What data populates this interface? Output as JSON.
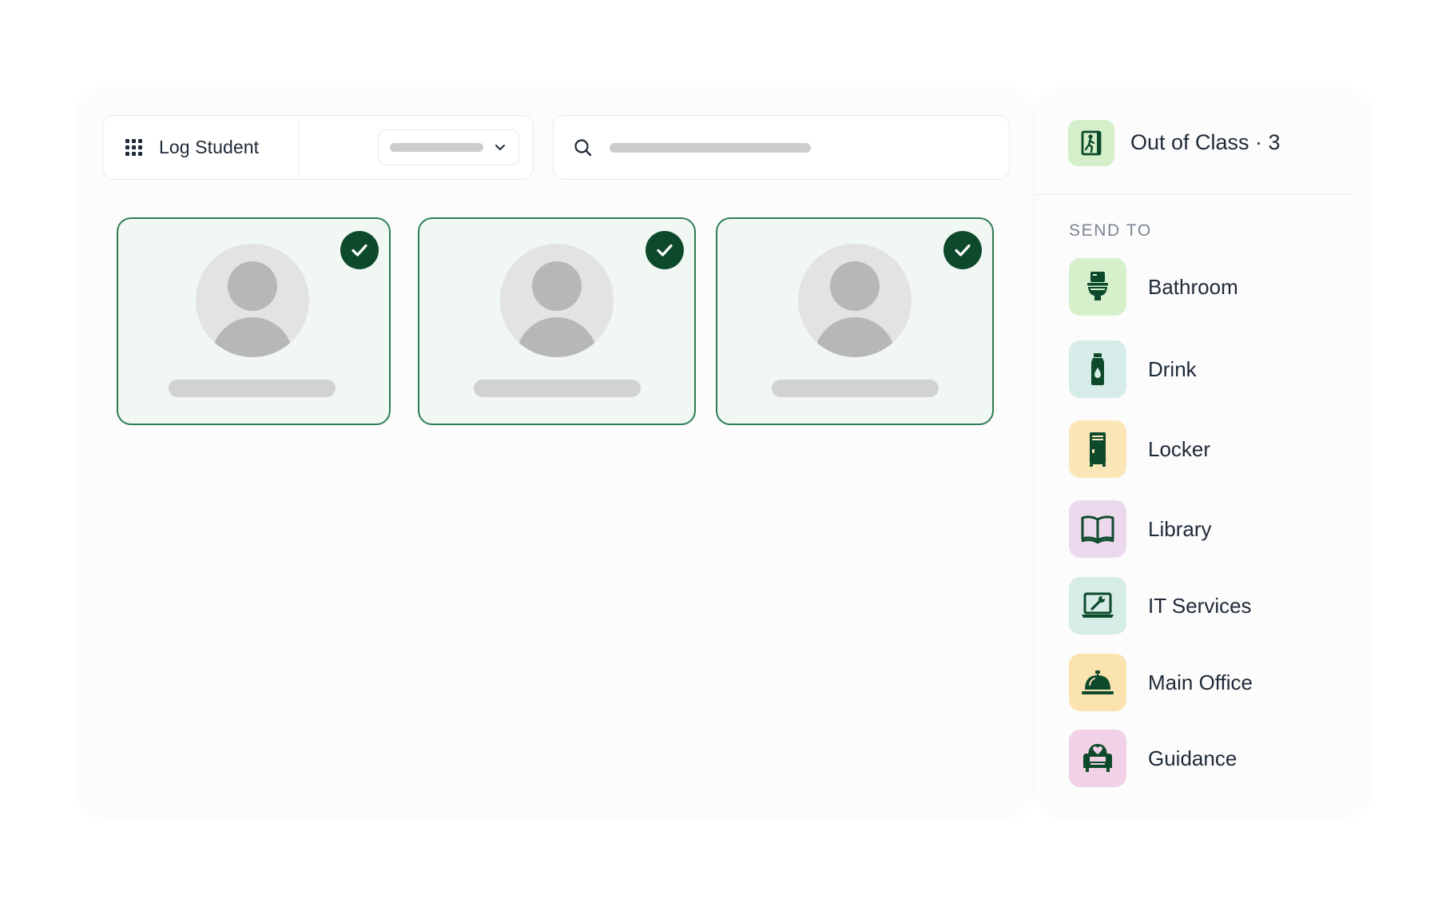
{
  "toolbar": {
    "log_label": "Log Student",
    "grid_icon": "grid-icon",
    "filter_select_value": "",
    "search_placeholder": "",
    "search_icon": "search-icon"
  },
  "students": [
    {
      "name": "",
      "selected": true
    },
    {
      "name": "",
      "selected": true
    },
    {
      "name": "",
      "selected": true
    }
  ],
  "sidebar": {
    "header_label": "Out of Class · 3",
    "header_icon": "exit-door-icon",
    "send_to_label": "SEND TO",
    "destinations": [
      {
        "label": "Bathroom",
        "icon": "toilet-icon",
        "bg": "#d6f0cc"
      },
      {
        "label": "Drink",
        "icon": "water-bottle-icon",
        "bg": "#d5ece8"
      },
      {
        "label": "Locker",
        "icon": "locker-icon",
        "bg": "#fbe6b7"
      },
      {
        "label": "Library",
        "icon": "book-icon",
        "bg": "#ecd9ee"
      },
      {
        "label": "IT Services",
        "icon": "laptop-wrench-icon",
        "bg": "#d6ece6"
      },
      {
        "label": "Main Office",
        "icon": "service-bell-icon",
        "bg": "#fbe3b0"
      },
      {
        "label": "Guidance",
        "icon": "armchair-heart-icon",
        "bg": "#f0d1e5"
      }
    ]
  },
  "colors": {
    "accent_dark_green": "#0d4a2c",
    "card_border_green": "#2e7d54",
    "card_bg": "#f1f7f3",
    "skeleton_gray": "#cdcdcd"
  }
}
